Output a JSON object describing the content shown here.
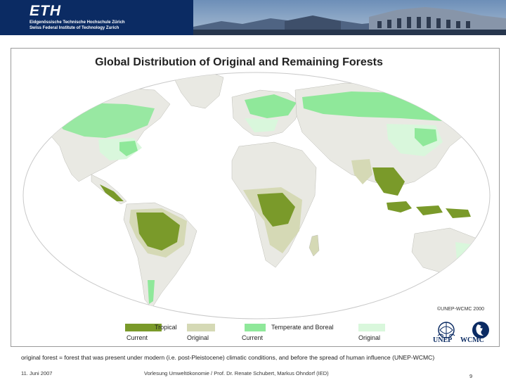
{
  "header": {
    "logo_text": "ETH",
    "line1": "Eidgenössische Technische Hochschule Zürich",
    "line2": "Swiss Federal Institute of Technology Zurich",
    "colors": {
      "background": "#0b2b63",
      "text": "#ffffff"
    }
  },
  "map": {
    "title": "Global Distribution of Original and Remaining Forests",
    "copyright": "©UNEP-WCMC 2000",
    "colors": {
      "tropical_current": "#7a9a2a",
      "tropical_original": "#d5d9b5",
      "temperate_current": "#8fe89a",
      "temperate_original": "#d9f7dc",
      "land": "#e9e9e3",
      "ocean": "#ffffff"
    }
  },
  "legend": {
    "tropical": {
      "group_label": "Tropical",
      "current_label": "Current",
      "original_label": "Original"
    },
    "temperate": {
      "group_label": "Temperate and Boreal",
      "current_label": "Current",
      "original_label": "Original"
    }
  },
  "logos": {
    "unep": "UNEP",
    "wcmc": "WCMC"
  },
  "caption": "original forest = forest that was present under modern (i.e. post-Pleistocene) climatic conditions, and before the spread of human influence (UNEP-WCMC)",
  "footer": {
    "date": "11. Juni 2007",
    "lecture": "Vorlesung Umweltökonomie / Prof. Dr. Renate Schubert, Markus Ohndorf (IED)",
    "page": "9"
  }
}
